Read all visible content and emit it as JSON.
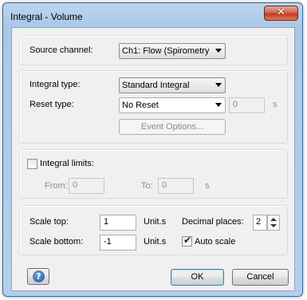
{
  "window": {
    "title": "Integral - Volume",
    "close_glyph": "✕"
  },
  "source": {
    "label": "Source channel:",
    "value": "Ch1: Flow (Spirometry"
  },
  "integral": {
    "type_label": "Integral type:",
    "type_value": "Standard Integral",
    "reset_label": "Reset type:",
    "reset_value": "No Reset",
    "reset_amount": "0",
    "reset_unit": "s",
    "event_options": "Event Options..."
  },
  "limits": {
    "checkbox_label": "Integral limits:",
    "checked": false,
    "from_label": "From:",
    "from_value": "0",
    "to_label": "To:",
    "to_value": "0",
    "unit": "s"
  },
  "scale": {
    "top_label": "Scale top:",
    "top_value": "1",
    "top_unit": "Unit.s",
    "bottom_label": "Scale bottom:",
    "bottom_value": "-1",
    "bottom_unit": "Unit.s",
    "decimal_label": "Decimal places:",
    "decimal_value": "2",
    "auto_label": "Auto scale",
    "auto_checked": true,
    "check_glyph": "✔"
  },
  "buttons": {
    "help_glyph": "?",
    "ok": "OK",
    "cancel": "Cancel"
  }
}
